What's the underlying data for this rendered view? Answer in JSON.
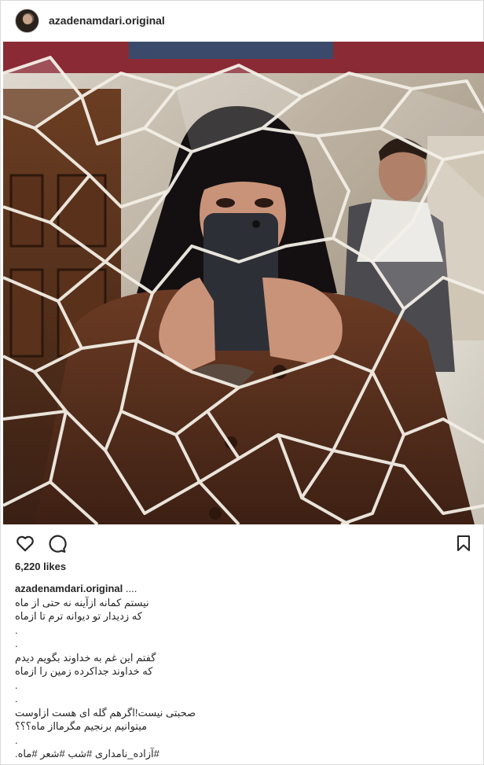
{
  "post": {
    "username": "azadenamdari.original",
    "photo_alt": "selfie in broken mirror mosaic",
    "likes": "6,220 likes",
    "caption": {
      "username": "azadenamdari.original",
      "first_suffix": " ....",
      "lines": [
        "نیستم کمانه ازآینه نه حتی از ماه",
        "که زدیدار تو دیوانه ترم تا ازماه",
        ".",
        ".",
        "گفتم این غم به خداوند بگویم دیدم",
        "که خداوند جداکرده زمین را ازماه",
        ".",
        ".",
        "صحبتی نیست!اگرهم گله ای هست ازاوست",
        "میتوانیم برنجیم مگرمااز ماه؟؟؟",
        ".",
        "#آزاده_نامداری #شب #شعر #ماه."
      ]
    }
  },
  "icons": {
    "like": "heart-icon",
    "comment": "comment-bubble-icon",
    "save": "bookmark-icon"
  }
}
